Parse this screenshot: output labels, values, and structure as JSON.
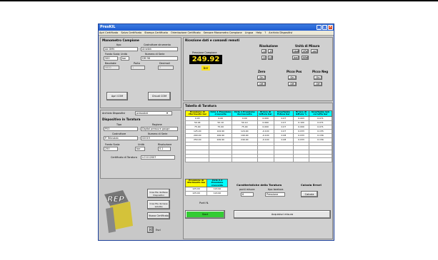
{
  "window": {
    "title": "PresKIL"
  },
  "menu": [
    "Apri Certificato",
    "Salva Certificato",
    "Stampa Certificato",
    "Orientazione Certificato",
    "Sensore Manometro Campione",
    "Lingua",
    "Help",
    "?",
    "Archivio Dispositivi"
  ],
  "manometro": {
    "title": "Manometro Campione",
    "tipo_label": "tipo",
    "tipo_value": "Ad DMV",
    "costruttore_label": "Costruttore strumento",
    "costruttore_value": "Ametek",
    "fondo_label": "Fondo Scala",
    "fondo_value": "500",
    "unita_label": "Unità",
    "unita_value": "bar",
    "matricola_label": "Numero di Serie",
    "matricola_value": "DM 98",
    "baudrate_label": "Baudrate",
    "baudrate_value": "9600",
    "porta_label": "Porta",
    "porta_value": "1",
    "decimali_label": "Decimali",
    "decimali_value": "2",
    "apri_com": "Apri COM",
    "chiudi_com": "Chiudi COM"
  },
  "lettura": {
    "title": "Ricezione dati e comandi remoti",
    "pressione_label": "Pressione Campione",
    "pressione_value": "249.92",
    "unit": "bar",
    "risoluzione_title": "Risoluzione",
    "ris_buttons": [
      "1",
      "2",
      "5",
      "10"
    ],
    "unita_title": "Unità di Misura",
    "unita_buttons": [
      "mbar",
      "kPa",
      "psi",
      "bar",
      "MPa"
    ],
    "zero_title": "Zero",
    "zero_buttons": [
      "On",
      "Off"
    ],
    "picco_pos_title": "Picco Pos",
    "picco_pos_buttons": [
      "On",
      "Off"
    ],
    "picco_neg_title": "Picco Neg",
    "picco_neg_buttons": [
      "On",
      "Off"
    ]
  },
  "dispositivo": {
    "archivio_label": "Archivio Dispositivi",
    "archivio_value": "presostat",
    "title": "Dispositivo in Taratura",
    "tipo_label": "Tipo",
    "tipo_value": "P03",
    "ragione_label": "Ragione",
    "ragione_value": "Digital pressure gauge",
    "costruttore_label": "Costruttore",
    "costruttore_value": "P. Teknolab",
    "seriale_label": "Numero di Serie",
    "seriale_value": "02019",
    "fondo_label": "Fondo Scala",
    "fondo_value": "250",
    "unita_label": "Unità",
    "unita_value": "bar",
    "risoluzione_label": "Risoluzione",
    "risoluzione_value": "0.1",
    "certificato_label": "Certificato di Taratura",
    "certificato_value": "LC1112007"
  },
  "tabella": {
    "title": "Tabella di Taratura",
    "headers": [
      "Pressione di riferimento bar",
      "Ciclo 1 Pressione crescente",
      "Ciclo 1 Pressione decrescente",
      "Errore di lettura bar",
      "Incertezza Estesa bar",
      "Errore di lettura %",
      "Incertezza non corretta bar"
    ],
    "rows": [
      [
        "0.03",
        "0.00",
        "0.00",
        "0.000",
        "0.07",
        "0.003",
        "0.071"
      ],
      [
        "50.04",
        "50.10",
        "50.10",
        "0.060",
        "0.07",
        "0.100",
        "0.071"
      ],
      [
        "75.00",
        "75.00",
        "75.00",
        "0.000",
        "0.07",
        "0.000",
        "0.071"
      ],
      [
        "125.00",
        "124.90",
        "124.90",
        "-0.100",
        "0.07",
        "0.033",
        "0.155"
      ],
      [
        "200.00",
        "199.90",
        "199.90",
        "-0.100",
        "0.08",
        "0.033",
        "0.156"
      ],
      [
        "250.00",
        "249.90",
        "249.90",
        "-0.100",
        "0.08",
        "0.033",
        "0.156"
      ]
    ],
    "empty_rows": 5
  },
  "sotto": {
    "headers": [
      "Pressione di riferimento bar",
      "Ciclo 2-3 Pressione crescente"
    ],
    "rows": [
      [
        "125.00",
        "124.90"
      ],
      [
        "125.00",
        "124.90"
      ]
    ],
    "puntolibera": "Punti N.",
    "caratteristiche_title": "Caratteristiche della Taratura",
    "punti_label": "punti misura",
    "punti_value": "6",
    "tipo_label": "tipo taratura",
    "tipo_value": "Pressione",
    "calcolo_title": "Calcola Errori",
    "calcola": "Calcola"
  },
  "left_buttons": {
    "crea_file": "Crea file da Base Dispositivi",
    "crea_file2": "Crea file da base salvate",
    "nuovo": "Nuovo Certificato",
    "esci": "Esci"
  },
  "bottom": {
    "start": "Start",
    "acquisisci": "Acquisisci misura"
  },
  "colors": {
    "title_bar": "#1f5bd0",
    "display_bg": "#000000",
    "display_fg": "#ffe31a",
    "header_yellow": "#ffff00",
    "header_cyan": "#00ffff",
    "start_green": "#33cc33"
  }
}
